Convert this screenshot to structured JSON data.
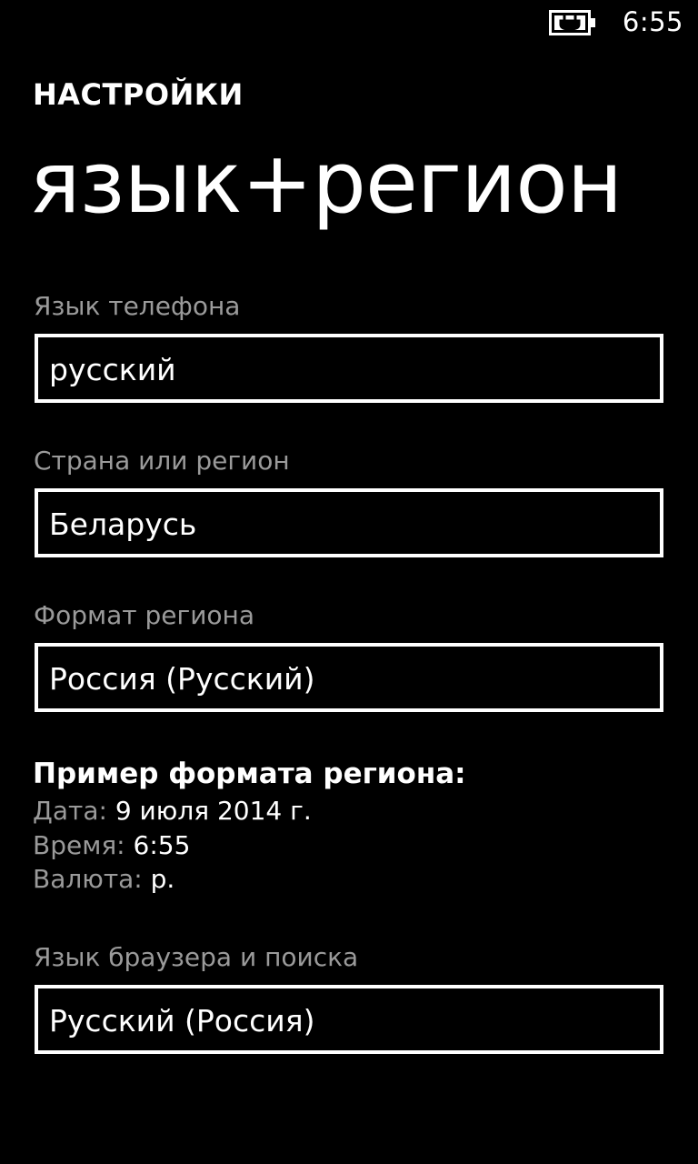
{
  "status_bar": {
    "battery_icon": "battery-charging-icon",
    "time": "6:55"
  },
  "header": {
    "app_title": "НАСТРОЙКИ",
    "page_title": "язык+регион"
  },
  "fields": {
    "phone_language": {
      "label": "Язык телефона",
      "value": "русский"
    },
    "country_region": {
      "label": "Страна или регион",
      "value": "Беларусь"
    },
    "region_format": {
      "label": "Формат региона",
      "value": "Россия (Русский)"
    },
    "browser_search_language": {
      "label": "Язык браузера и поиска",
      "value": "Русский (Россия)"
    }
  },
  "format_sample": {
    "heading": "Пример формата региона:",
    "date_label": "Дата:",
    "date_value": "9 июля 2014 г.",
    "time_label": "Время:",
    "time_value": "6:55",
    "currency_label": "Валюта:",
    "currency_value": "р."
  },
  "colors": {
    "background": "#000000",
    "foreground": "#ffffff",
    "label": "#9a9a9a"
  }
}
